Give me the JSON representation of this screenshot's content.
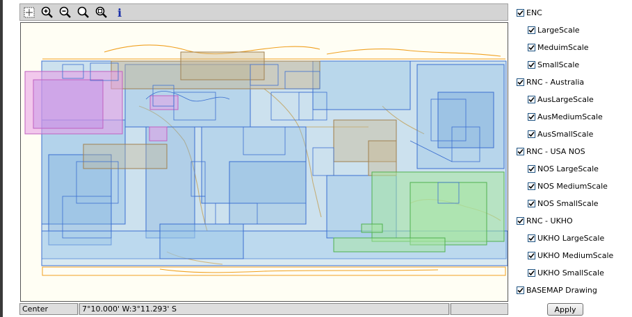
{
  "toolbar": {
    "tools": [
      {
        "name": "select-box-icon"
      },
      {
        "name": "zoom-in-icon"
      },
      {
        "name": "zoom-out-icon"
      },
      {
        "name": "zoom-previous-icon"
      },
      {
        "name": "zoom-full-icon"
      },
      {
        "name": "info-icon",
        "glyph": "i"
      }
    ]
  },
  "colors": {
    "enc_blue": "#8fbfe6",
    "aus_brown": "#c9b48a",
    "nos_pink": "#e79be6",
    "ukho_green": "#a6e6a0",
    "basemap_orange": "#f0a020",
    "outline_blue": "#3b6fd0"
  },
  "status": {
    "center_label": "Center",
    "coords": "7°10.000' W:3°11.293' S"
  },
  "layers": {
    "items": [
      {
        "label": "ENC",
        "checked": true
      },
      {
        "label": "LargeScale",
        "checked": true
      },
      {
        "label": "MeduimScale",
        "checked": true
      },
      {
        "label": "SmallScale",
        "checked": true
      },
      {
        "label": "RNC - Australia",
        "checked": true
      },
      {
        "label": "AusLargeScale",
        "checked": true
      },
      {
        "label": "AusMediumScale",
        "checked": true
      },
      {
        "label": "AusSmallScale",
        "checked": true
      },
      {
        "label": "RNC - USA NOS",
        "checked": true
      },
      {
        "label": "NOS LargeScale",
        "checked": true
      },
      {
        "label": "NOS MediumScale",
        "checked": true
      },
      {
        "label": "NOS SmallScale",
        "checked": true
      },
      {
        "label": "RNC - UKHO",
        "checked": true
      },
      {
        "label": "UKHO LargeScale",
        "checked": true
      },
      {
        "label": "UKHO MediumScale",
        "checked": true
      },
      {
        "label": "UKHO SmallScale",
        "checked": true
      },
      {
        "label": "BASEMAP Drawing",
        "checked": true
      }
    ],
    "apply_label": "Apply"
  }
}
